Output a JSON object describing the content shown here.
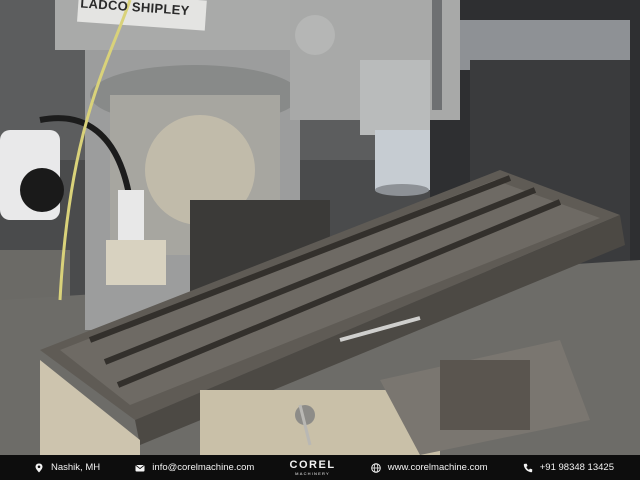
{
  "photo": {
    "machine_plate_text": "LADCO SHIPLEY",
    "description_colors": {
      "table_steel": "#5f5b55",
      "column_gray": "#9fa0a0",
      "base_cream": "#cdc4ae",
      "spindle_silver": "#c6ccd2"
    }
  },
  "footer": {
    "location": "Nashik, MH",
    "email": "info@corelmachine.com",
    "brand_name": "COREL",
    "brand_sub": "MACHINERY",
    "website": "www.corelmachine.com",
    "phone": "+91 98348 13425",
    "colors": {
      "background": "#0d0d0d",
      "text": "#f2f2f2"
    }
  }
}
